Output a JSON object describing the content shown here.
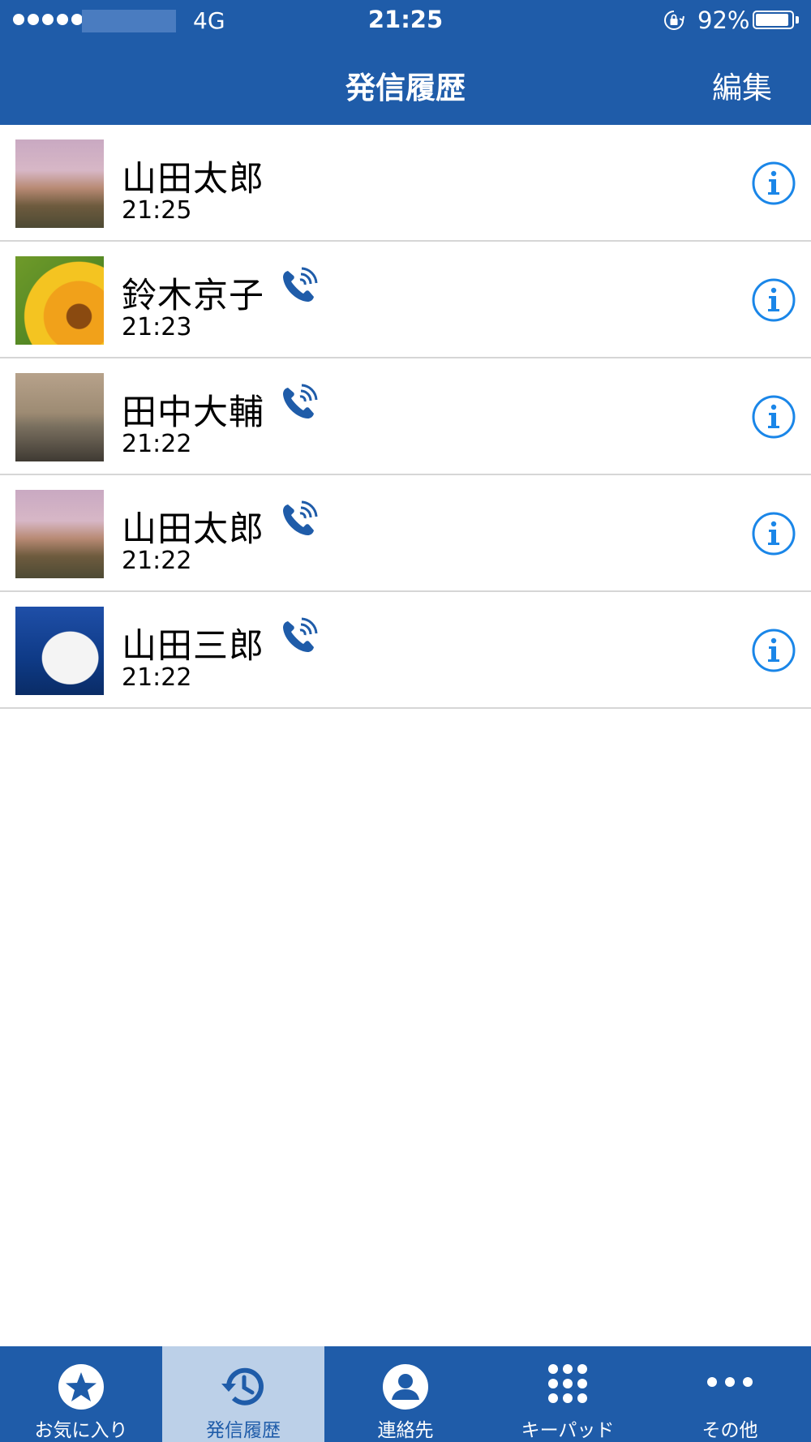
{
  "status_bar": {
    "network": "4G",
    "time": "21:25",
    "battery_percent": "92%",
    "battery_level": 0.92,
    "orientation_lock_icon": "orientation-lock-icon"
  },
  "nav": {
    "title": "発信履歴",
    "edit_label": "編集"
  },
  "calls": [
    {
      "name": "山田太郎",
      "time": "21:25",
      "avatar": "castle",
      "has_call_icon": false
    },
    {
      "name": "鈴木京子",
      "time": "21:23",
      "avatar": "sunflower",
      "has_call_icon": true
    },
    {
      "name": "田中大輔",
      "time": "21:22",
      "avatar": "car",
      "has_call_icon": true
    },
    {
      "name": "山田太郎",
      "time": "21:22",
      "avatar": "castle",
      "has_call_icon": true
    },
    {
      "name": "山田三郎",
      "time": "21:22",
      "avatar": "seagull",
      "has_call_icon": true
    }
  ],
  "tabs": [
    {
      "label": "お気に入り",
      "icon": "star-icon",
      "active": false
    },
    {
      "label": "発信履歴",
      "icon": "history-icon",
      "active": true
    },
    {
      "label": "連絡先",
      "icon": "person-icon",
      "active": false
    },
    {
      "label": "キーパッド",
      "icon": "keypad-icon",
      "active": false
    },
    {
      "label": "その他",
      "icon": "more-icon",
      "active": false
    }
  ],
  "colors": {
    "primary": "#1f5ca9",
    "active_tab_bg": "#bcd0e8",
    "info_blue": "#1a86e8",
    "call_icon": "#1f5ca9",
    "divider": "#d6d6d6"
  }
}
